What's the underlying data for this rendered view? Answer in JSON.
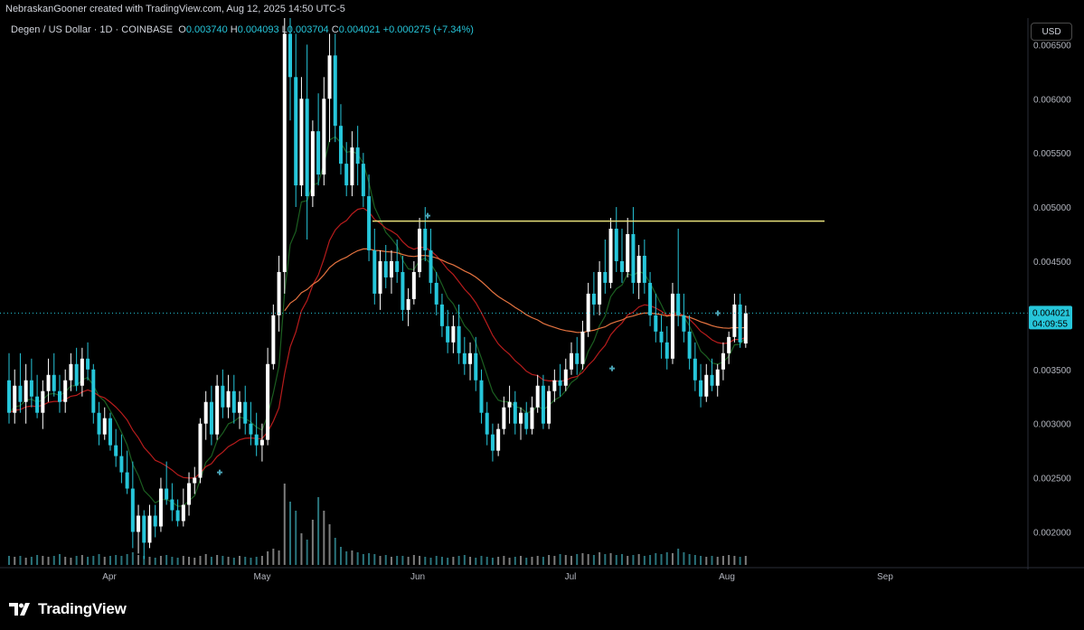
{
  "header": {
    "caption": "NebraskanGooner created with TradingView.com, Aug 12, 2025 14:50 UTC-5"
  },
  "legend": {
    "symbol": "Degen / US Dollar · 1D · COINBASE",
    "open_label": "O",
    "open": "0.003740",
    "high_label": "H",
    "high": "0.004093",
    "low_label": "L",
    "low": "0.003704",
    "close_label": "C",
    "close": "0.004021",
    "change": "+0.000275 (+7.34%)"
  },
  "currency_button": "USD",
  "brand": {
    "name": "TradingView"
  },
  "colors": {
    "background": "#000000",
    "up": "#ffffff",
    "down": "#26c6da",
    "ema_fast": "#1b5e20",
    "ema_mid": "#b71c1c",
    "ema_slow": "#e57340",
    "resistance": "#e6e07a",
    "price_badge": "#26c6da"
  },
  "chart_data": {
    "type": "candlestick",
    "x_ticks": [
      "Apr",
      "May",
      "Jun",
      "Jul",
      "Aug",
      "Sep"
    ],
    "y_ticks": [
      "0.002000",
      "0.002500",
      "0.003000",
      "0.003500",
      "0.004000",
      "0.004500",
      "0.005000",
      "0.005500",
      "0.006000",
      "0.006500"
    ],
    "ylim": [
      0.00167,
      0.006745
    ],
    "current_price": {
      "value": "0.004021",
      "countdown": "04:09:55"
    },
    "resistance_level": 0.00487,
    "candles": [
      {
        "o": 0.0034,
        "h": 0.00365,
        "l": 0.003,
        "c": 0.0031
      },
      {
        "o": 0.0031,
        "h": 0.0035,
        "l": 0.003,
        "c": 0.00335
      },
      {
        "o": 0.00335,
        "h": 0.00365,
        "l": 0.0031,
        "c": 0.0032
      },
      {
        "o": 0.0032,
        "h": 0.00355,
        "l": 0.003,
        "c": 0.0034
      },
      {
        "o": 0.0034,
        "h": 0.0036,
        "l": 0.00315,
        "c": 0.00325
      },
      {
        "o": 0.00325,
        "h": 0.00345,
        "l": 0.00305,
        "c": 0.0031
      },
      {
        "o": 0.0031,
        "h": 0.0034,
        "l": 0.00295,
        "c": 0.0033
      },
      {
        "o": 0.0033,
        "h": 0.0036,
        "l": 0.0032,
        "c": 0.00345
      },
      {
        "o": 0.00345,
        "h": 0.00365,
        "l": 0.00325,
        "c": 0.0033
      },
      {
        "o": 0.0033,
        "h": 0.00345,
        "l": 0.0031,
        "c": 0.0032
      },
      {
        "o": 0.0032,
        "h": 0.0035,
        "l": 0.0031,
        "c": 0.0034
      },
      {
        "o": 0.0034,
        "h": 0.00365,
        "l": 0.0033,
        "c": 0.00355
      },
      {
        "o": 0.00355,
        "h": 0.0037,
        "l": 0.0033,
        "c": 0.00335
      },
      {
        "o": 0.00335,
        "h": 0.0037,
        "l": 0.00325,
        "c": 0.0036
      },
      {
        "o": 0.0036,
        "h": 0.00375,
        "l": 0.0034,
        "c": 0.0035
      },
      {
        "o": 0.0035,
        "h": 0.00355,
        "l": 0.003,
        "c": 0.0031
      },
      {
        "o": 0.0031,
        "h": 0.0032,
        "l": 0.0028,
        "c": 0.0029
      },
      {
        "o": 0.0029,
        "h": 0.00315,
        "l": 0.00285,
        "c": 0.00305
      },
      {
        "o": 0.00305,
        "h": 0.0031,
        "l": 0.00275,
        "c": 0.0028
      },
      {
        "o": 0.0028,
        "h": 0.00295,
        "l": 0.0026,
        "c": 0.0027
      },
      {
        "o": 0.0027,
        "h": 0.0029,
        "l": 0.00245,
        "c": 0.00255
      },
      {
        "o": 0.00255,
        "h": 0.00275,
        "l": 0.00235,
        "c": 0.0024
      },
      {
        "o": 0.0024,
        "h": 0.00265,
        "l": 0.00185,
        "c": 0.002
      },
      {
        "o": 0.002,
        "h": 0.00225,
        "l": 0.0018,
        "c": 0.00215
      },
      {
        "o": 0.00215,
        "h": 0.0022,
        "l": 0.00175,
        "c": 0.0019
      },
      {
        "o": 0.0019,
        "h": 0.00225,
        "l": 0.00185,
        "c": 0.00215
      },
      {
        "o": 0.00215,
        "h": 0.00225,
        "l": 0.00195,
        "c": 0.00205
      },
      {
        "o": 0.00205,
        "h": 0.0025,
        "l": 0.002,
        "c": 0.0024
      },
      {
        "o": 0.0024,
        "h": 0.00265,
        "l": 0.00225,
        "c": 0.0023
      },
      {
        "o": 0.0023,
        "h": 0.00245,
        "l": 0.0021,
        "c": 0.0022
      },
      {
        "o": 0.0022,
        "h": 0.0023,
        "l": 0.00205,
        "c": 0.0021
      },
      {
        "o": 0.0021,
        "h": 0.0024,
        "l": 0.00205,
        "c": 0.00225
      },
      {
        "o": 0.00225,
        "h": 0.00255,
        "l": 0.00215,
        "c": 0.00245
      },
      {
        "o": 0.00245,
        "h": 0.0026,
        "l": 0.00235,
        "c": 0.0025
      },
      {
        "o": 0.0025,
        "h": 0.00305,
        "l": 0.00245,
        "c": 0.003
      },
      {
        "o": 0.003,
        "h": 0.0033,
        "l": 0.00285,
        "c": 0.0032
      },
      {
        "o": 0.0032,
        "h": 0.00335,
        "l": 0.0028,
        "c": 0.0029
      },
      {
        "o": 0.0029,
        "h": 0.00345,
        "l": 0.00285,
        "c": 0.00335
      },
      {
        "o": 0.00335,
        "h": 0.0035,
        "l": 0.00305,
        "c": 0.00315
      },
      {
        "o": 0.00315,
        "h": 0.00345,
        "l": 0.00305,
        "c": 0.0033
      },
      {
        "o": 0.0033,
        "h": 0.00345,
        "l": 0.003,
        "c": 0.0031
      },
      {
        "o": 0.0031,
        "h": 0.0033,
        "l": 0.00295,
        "c": 0.0032
      },
      {
        "o": 0.0032,
        "h": 0.00335,
        "l": 0.0029,
        "c": 0.003
      },
      {
        "o": 0.003,
        "h": 0.0032,
        "l": 0.0028,
        "c": 0.0029
      },
      {
        "o": 0.0029,
        "h": 0.0031,
        "l": 0.0027,
        "c": 0.0028
      },
      {
        "o": 0.0028,
        "h": 0.003,
        "l": 0.00265,
        "c": 0.00285
      },
      {
        "o": 0.00285,
        "h": 0.0037,
        "l": 0.0028,
        "c": 0.00355
      },
      {
        "o": 0.00355,
        "h": 0.0041,
        "l": 0.0035,
        "c": 0.004
      },
      {
        "o": 0.004,
        "h": 0.00455,
        "l": 0.00385,
        "c": 0.0044
      },
      {
        "o": 0.0044,
        "h": 0.0068,
        "l": 0.0042,
        "c": 0.0066
      },
      {
        "o": 0.0066,
        "h": 0.0069,
        "l": 0.0058,
        "c": 0.0062
      },
      {
        "o": 0.0062,
        "h": 0.0066,
        "l": 0.005,
        "c": 0.0052
      },
      {
        "o": 0.0052,
        "h": 0.0062,
        "l": 0.0051,
        "c": 0.006
      },
      {
        "o": 0.006,
        "h": 0.0065,
        "l": 0.0047,
        "c": 0.0051
      },
      {
        "o": 0.0051,
        "h": 0.0058,
        "l": 0.005,
        "c": 0.0057
      },
      {
        "o": 0.0057,
        "h": 0.00605,
        "l": 0.0052,
        "c": 0.0053
      },
      {
        "o": 0.0053,
        "h": 0.0062,
        "l": 0.0052,
        "c": 0.006
      },
      {
        "o": 0.006,
        "h": 0.0066,
        "l": 0.0056,
        "c": 0.0064
      },
      {
        "o": 0.0064,
        "h": 0.0066,
        "l": 0.0056,
        "c": 0.00575
      },
      {
        "o": 0.00575,
        "h": 0.00595,
        "l": 0.0053,
        "c": 0.0054
      },
      {
        "o": 0.0054,
        "h": 0.0056,
        "l": 0.0051,
        "c": 0.0052
      },
      {
        "o": 0.0052,
        "h": 0.0057,
        "l": 0.0051,
        "c": 0.00555
      },
      {
        "o": 0.00555,
        "h": 0.00575,
        "l": 0.0052,
        "c": 0.0054
      },
      {
        "o": 0.0054,
        "h": 0.0055,
        "l": 0.005,
        "c": 0.0051
      },
      {
        "o": 0.0051,
        "h": 0.0053,
        "l": 0.0045,
        "c": 0.0046
      },
      {
        "o": 0.0046,
        "h": 0.0048,
        "l": 0.0041,
        "c": 0.0042
      },
      {
        "o": 0.0042,
        "h": 0.0046,
        "l": 0.00405,
        "c": 0.0045
      },
      {
        "o": 0.0045,
        "h": 0.00465,
        "l": 0.00425,
        "c": 0.00435
      },
      {
        "o": 0.00435,
        "h": 0.0046,
        "l": 0.0042,
        "c": 0.0045
      },
      {
        "o": 0.0045,
        "h": 0.0047,
        "l": 0.0043,
        "c": 0.0044
      },
      {
        "o": 0.0044,
        "h": 0.00455,
        "l": 0.00395,
        "c": 0.00405
      },
      {
        "o": 0.00405,
        "h": 0.00425,
        "l": 0.0039,
        "c": 0.00415
      },
      {
        "o": 0.00415,
        "h": 0.0045,
        "l": 0.0041,
        "c": 0.0044
      },
      {
        "o": 0.0044,
        "h": 0.0049,
        "l": 0.00435,
        "c": 0.0048
      },
      {
        "o": 0.0048,
        "h": 0.005,
        "l": 0.0045,
        "c": 0.0046
      },
      {
        "o": 0.0046,
        "h": 0.0048,
        "l": 0.0042,
        "c": 0.0043
      },
      {
        "o": 0.0043,
        "h": 0.0044,
        "l": 0.004,
        "c": 0.0041
      },
      {
        "o": 0.0041,
        "h": 0.0042,
        "l": 0.0038,
        "c": 0.0039
      },
      {
        "o": 0.0039,
        "h": 0.00405,
        "l": 0.00365,
        "c": 0.00375
      },
      {
        "o": 0.00375,
        "h": 0.004,
        "l": 0.00365,
        "c": 0.0039
      },
      {
        "o": 0.0039,
        "h": 0.0041,
        "l": 0.00355,
        "c": 0.00365
      },
      {
        "o": 0.00365,
        "h": 0.0038,
        "l": 0.00345,
        "c": 0.00355
      },
      {
        "o": 0.00355,
        "h": 0.00375,
        "l": 0.0034,
        "c": 0.00365
      },
      {
        "o": 0.00365,
        "h": 0.0038,
        "l": 0.0033,
        "c": 0.0034
      },
      {
        "o": 0.0034,
        "h": 0.0035,
        "l": 0.003,
        "c": 0.0031
      },
      {
        "o": 0.0031,
        "h": 0.0032,
        "l": 0.0028,
        "c": 0.0029
      },
      {
        "o": 0.0029,
        "h": 0.003,
        "l": 0.00265,
        "c": 0.00275
      },
      {
        "o": 0.00275,
        "h": 0.003,
        "l": 0.0027,
        "c": 0.00295
      },
      {
        "o": 0.00295,
        "h": 0.00325,
        "l": 0.0029,
        "c": 0.00315
      },
      {
        "o": 0.00315,
        "h": 0.00335,
        "l": 0.003,
        "c": 0.0032
      },
      {
        "o": 0.0032,
        "h": 0.0033,
        "l": 0.0029,
        "c": 0.003
      },
      {
        "o": 0.003,
        "h": 0.00315,
        "l": 0.00285,
        "c": 0.0031
      },
      {
        "o": 0.0031,
        "h": 0.0032,
        "l": 0.0029,
        "c": 0.00295
      },
      {
        "o": 0.00295,
        "h": 0.00325,
        "l": 0.0029,
        "c": 0.00315
      },
      {
        "o": 0.00315,
        "h": 0.00345,
        "l": 0.0031,
        "c": 0.00335
      },
      {
        "o": 0.00335,
        "h": 0.00345,
        "l": 0.00295,
        "c": 0.003
      },
      {
        "o": 0.003,
        "h": 0.00335,
        "l": 0.00295,
        "c": 0.0033
      },
      {
        "o": 0.0033,
        "h": 0.0035,
        "l": 0.0032,
        "c": 0.0034
      },
      {
        "o": 0.0034,
        "h": 0.00355,
        "l": 0.00325,
        "c": 0.00335
      },
      {
        "o": 0.00335,
        "h": 0.0036,
        "l": 0.0033,
        "c": 0.0035
      },
      {
        "o": 0.0035,
        "h": 0.00375,
        "l": 0.00345,
        "c": 0.00365
      },
      {
        "o": 0.00365,
        "h": 0.0038,
        "l": 0.00345,
        "c": 0.00355
      },
      {
        "o": 0.00355,
        "h": 0.00395,
        "l": 0.0035,
        "c": 0.00385
      },
      {
        "o": 0.00385,
        "h": 0.0043,
        "l": 0.0038,
        "c": 0.0042
      },
      {
        "o": 0.0042,
        "h": 0.0044,
        "l": 0.004,
        "c": 0.0041
      },
      {
        "o": 0.0041,
        "h": 0.0045,
        "l": 0.004,
        "c": 0.0044
      },
      {
        "o": 0.0044,
        "h": 0.0047,
        "l": 0.0042,
        "c": 0.0043
      },
      {
        "o": 0.0043,
        "h": 0.0049,
        "l": 0.00425,
        "c": 0.0048
      },
      {
        "o": 0.0048,
        "h": 0.005,
        "l": 0.0044,
        "c": 0.0045
      },
      {
        "o": 0.0045,
        "h": 0.0048,
        "l": 0.0043,
        "c": 0.0044
      },
      {
        "o": 0.0044,
        "h": 0.0049,
        "l": 0.00435,
        "c": 0.00475
      },
      {
        "o": 0.00475,
        "h": 0.005,
        "l": 0.0042,
        "c": 0.0043
      },
      {
        "o": 0.0043,
        "h": 0.00465,
        "l": 0.00415,
        "c": 0.00455
      },
      {
        "o": 0.00455,
        "h": 0.0047,
        "l": 0.0042,
        "c": 0.0043
      },
      {
        "o": 0.0043,
        "h": 0.0044,
        "l": 0.0039,
        "c": 0.004
      },
      {
        "o": 0.004,
        "h": 0.0042,
        "l": 0.00375,
        "c": 0.00385
      },
      {
        "o": 0.00385,
        "h": 0.004,
        "l": 0.0036,
        "c": 0.00375
      },
      {
        "o": 0.00375,
        "h": 0.0039,
        "l": 0.0035,
        "c": 0.0036
      },
      {
        "o": 0.0036,
        "h": 0.0043,
        "l": 0.00355,
        "c": 0.0042
      },
      {
        "o": 0.0042,
        "h": 0.0048,
        "l": 0.0039,
        "c": 0.004
      },
      {
        "o": 0.004,
        "h": 0.0042,
        "l": 0.00375,
        "c": 0.00385
      },
      {
        "o": 0.00385,
        "h": 0.004,
        "l": 0.0035,
        "c": 0.0036
      },
      {
        "o": 0.0036,
        "h": 0.00375,
        "l": 0.0033,
        "c": 0.0034
      },
      {
        "o": 0.0034,
        "h": 0.00355,
        "l": 0.00315,
        "c": 0.00325
      },
      {
        "o": 0.00325,
        "h": 0.00355,
        "l": 0.0032,
        "c": 0.00345
      },
      {
        "o": 0.00345,
        "h": 0.0036,
        "l": 0.0033,
        "c": 0.00335
      },
      {
        "o": 0.00335,
        "h": 0.00355,
        "l": 0.00325,
        "c": 0.0035
      },
      {
        "o": 0.0035,
        "h": 0.00375,
        "l": 0.0034,
        "c": 0.00365
      },
      {
        "o": 0.00365,
        "h": 0.00385,
        "l": 0.00355,
        "c": 0.0038
      },
      {
        "o": 0.0038,
        "h": 0.0042,
        "l": 0.00375,
        "c": 0.0041
      },
      {
        "o": 0.0041,
        "h": 0.0042,
        "l": 0.0037,
        "c": 0.00375
      },
      {
        "o": 0.00374,
        "h": 0.00409,
        "l": 0.0037,
        "c": 0.00402
      }
    ],
    "volume": [
      0.1,
      0.09,
      0.1,
      0.08,
      0.09,
      0.11,
      0.1,
      0.09,
      0.1,
      0.12,
      0.09,
      0.08,
      0.1,
      0.11,
      0.09,
      0.1,
      0.12,
      0.09,
      0.1,
      0.11,
      0.1,
      0.12,
      0.14,
      0.11,
      0.1,
      0.09,
      0.08,
      0.1,
      0.11,
      0.09,
      0.08,
      0.1,
      0.09,
      0.08,
      0.1,
      0.12,
      0.09,
      0.11,
      0.1,
      0.09,
      0.08,
      0.1,
      0.09,
      0.08,
      0.09,
      0.1,
      0.15,
      0.18,
      0.16,
      0.9,
      0.7,
      0.6,
      0.35,
      0.28,
      0.5,
      0.75,
      0.6,
      0.45,
      0.3,
      0.2,
      0.15,
      0.16,
      0.14,
      0.12,
      0.13,
      0.12,
      0.1,
      0.11,
      0.09,
      0.1,
      0.1,
      0.09,
      0.11,
      0.1,
      0.09,
      0.08,
      0.1,
      0.09,
      0.08,
      0.09,
      0.1,
      0.11,
      0.09,
      0.08,
      0.1,
      0.09,
      0.08,
      0.09,
      0.1,
      0.08,
      0.09,
      0.1,
      0.08,
      0.09,
      0.1,
      0.09,
      0.11,
      0.1,
      0.12,
      0.11,
      0.1,
      0.12,
      0.13,
      0.12,
      0.11,
      0.14,
      0.12,
      0.13,
      0.11,
      0.12,
      0.1,
      0.11,
      0.12,
      0.1,
      0.11,
      0.13,
      0.12,
      0.14,
      0.13,
      0.18,
      0.14,
      0.12,
      0.11,
      0.1,
      0.09,
      0.1,
      0.09,
      0.1,
      0.11,
      0.1,
      0.09,
      0.1
    ]
  }
}
